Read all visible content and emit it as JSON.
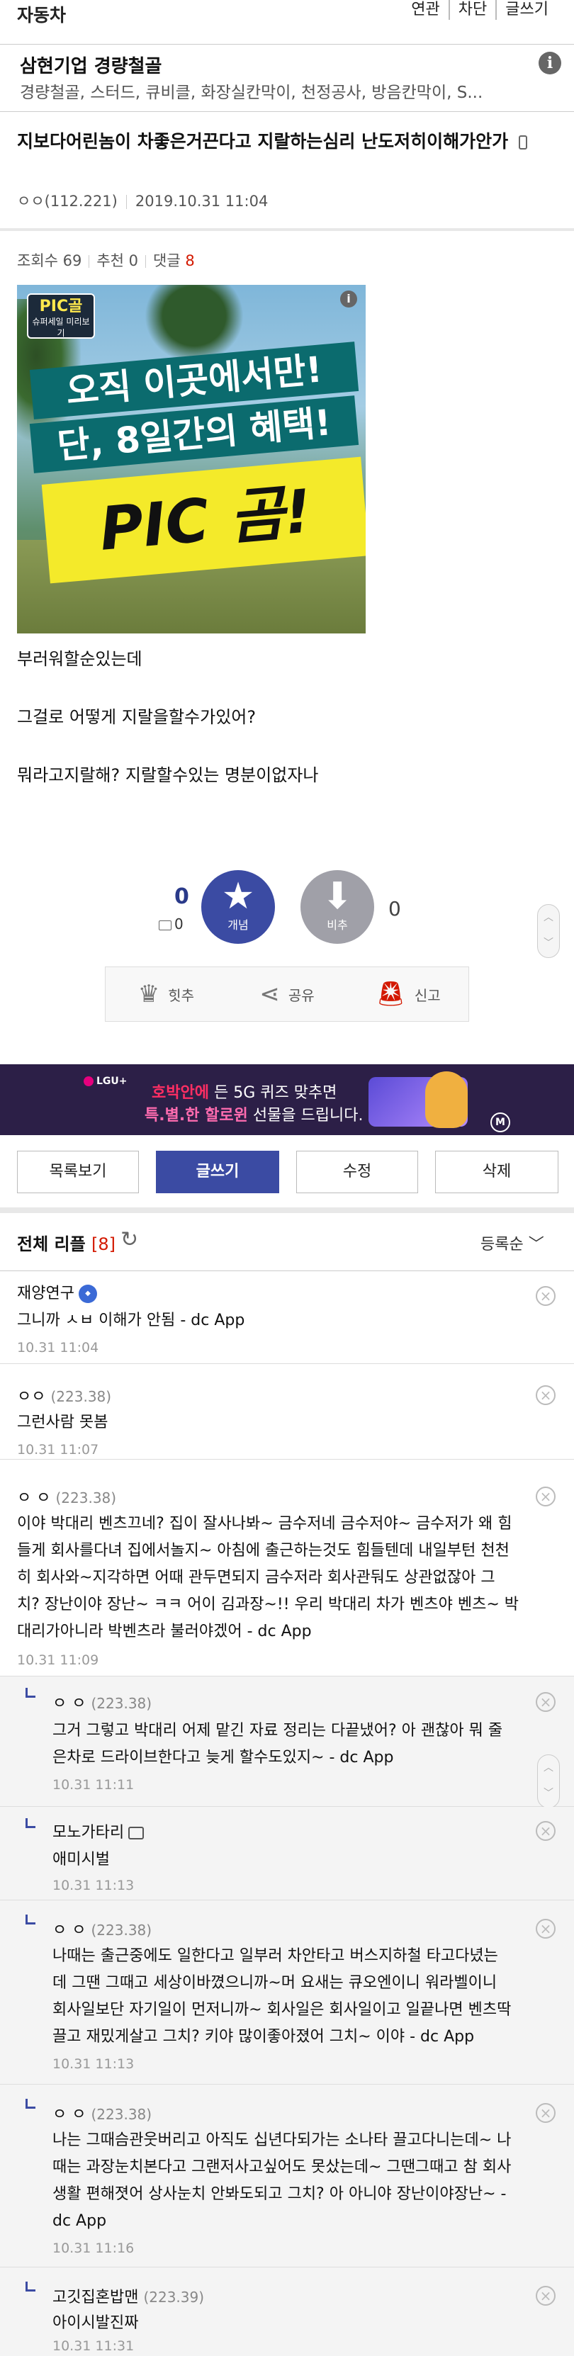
{
  "header": {
    "title": "자동차",
    "links": [
      "연관",
      "차단",
      "글쓰기"
    ]
  },
  "ad": {
    "title": "삼현기업 경량철골",
    "desc": "경량철골, 스터드, 큐비클, 화장실칸막이, 천정공사, 방음칸막이, S...",
    "info_icon": "i"
  },
  "post": {
    "title": "지보다어린놈이 차좋은거끈다고 지랄하는심리 난도저히이해가안가",
    "author": "ㅇㅇ(112.221)",
    "date": "2019.10.31 11:04",
    "views_label": "조회수 69",
    "recommend_label": "추천 0",
    "comments_label": "댓글",
    "comments_count": "8",
    "body": [
      "부러워할순있는데",
      "그걸로 어떻게 지랄을할수가있어?",
      "뭐라고지랄해? 지랄할수있는 명분이없자나"
    ]
  },
  "promo": {
    "badge_top": "PIC골",
    "badge_bottom": "슈퍼세일 미리보기",
    "line1": "오직 이곳에서만!",
    "line2": "단, 8일간의 혜택!",
    "line3": "PIC 곰!",
    "info": "i"
  },
  "vote": {
    "up_count": "0",
    "up_small": "0",
    "up_label": "개념",
    "down_label": "비추",
    "down_count": "0"
  },
  "actions": {
    "hit": "힛추",
    "share": "공유",
    "report": "신고"
  },
  "banner": {
    "brand": "LGU+",
    "line1_prefix": "호박안에",
    "line1_rest": " 든 5G 퀴즈 맞추면",
    "line2_pink": "특.별.한 할로윈",
    "line2_rest": " 선물을 드립니다.",
    "m": "M"
  },
  "buttons": {
    "list": "목록보기",
    "write": "글쓰기",
    "edit": "수정",
    "delete": "삭제"
  },
  "comments_header": {
    "label": "전체 리플",
    "count": "[8]",
    "sort": "등록순"
  },
  "comments": [
    {
      "nick": "재양연구",
      "ip": "",
      "text": [
        "그니까 ㅅㅂ 이해가 안됨 - dc App"
      ],
      "time": "10.31 11:04"
    },
    {
      "nick": "ㅇㅇ",
      "ip": "(223.38)",
      "text": [
        "그런사람 못봄"
      ],
      "time": "10.31 11:07"
    },
    {
      "nick": "ㅇ ㅇ",
      "ip": "(223.38)",
      "text": [
        "이야 박대리 벤츠끄네? 집이 잘사나봐~ 금수저네 금수저야~ 금수저가 왜 힘",
        "들게 회사를다녀 집에서놀지~ 아침에 출근하는것도 힘들텐데 내일부턴 천천",
        "히 회사와~지각하면 어때 관두면되지 금수저라 회사관둬도 상관없잖아 그",
        "치? 장난이야 장난~ ㅋㅋ 어이 김과장~!! 우리 박대리 차가 벤츠야 벤츠~ 박",
        "대리가아니라 박벤츠라 불러야겠어 - dc App"
      ],
      "time": "10.31 11:09"
    },
    {
      "nick": "ㅇ ㅇ",
      "ip": "(223.38)",
      "text": [
        "그거 그렇고 박대리 어제 맡긴 자료 정리는 다끝냈어? 아 괜찮아 뭐 줄",
        "은차로 드라이브한다고 늦게 할수도있지~ - dc App"
      ],
      "time": "10.31 11:11",
      "reply": true
    },
    {
      "nick": "모노가타리",
      "ip": "",
      "text": [
        "애미시벌"
      ],
      "time": "10.31 11:13",
      "reply": true
    },
    {
      "nick": "ㅇ ㅇ",
      "ip": "(223.38)",
      "text": [
        "나때는 출근중에도 일한다고 일부러 차안타고 버스지하철 타고다녔는",
        "데 그땐 그때고 세상이바꼈으니까~머 요새는 큐오엔이니 워라벨이니",
        "회사일보단 자기일이 먼저니까~ 회사일은 회사일이고 일끝나면 벤츠딱",
        "끌고 재밌게살고 그치? 키야 많이좋아졌어 그치~ 이야 - dc App"
      ],
      "time": "10.31 11:13",
      "reply": true
    },
    {
      "nick": "ㅇ ㅇ",
      "ip": "(223.38)",
      "text": [
        "나는 그때슴관웃버리고 아직도 십년다되가는 소나타 끌고다니는데~ 나",
        "때는 과장눈치본다고 그랜저사고싶어도 못샀는데~ 그땐그때고 참 회사",
        "생활 편해졋어 상사눈치 안봐도되고 그치? 아 아니야 장난이야장난~ -",
        "dc App"
      ],
      "time": "10.31 11:16",
      "reply": true
    },
    {
      "nick": "고깃집혼밥맨",
      "ip": "(223.39)",
      "text": [
        "아이시발진짜"
      ],
      "time": "10.31 11:31",
      "reply": true
    }
  ]
}
